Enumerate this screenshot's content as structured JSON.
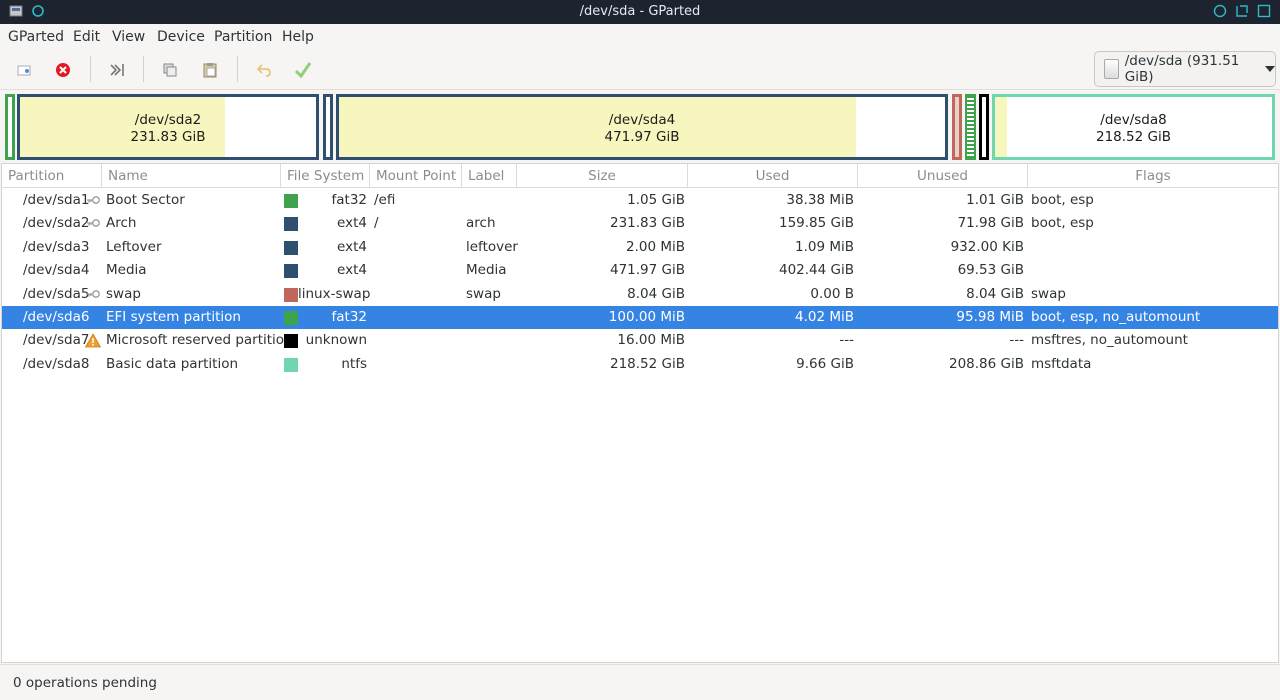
{
  "window": {
    "title": "/dev/sda - GParted"
  },
  "menu": [
    "GParted",
    "Edit",
    "View",
    "Device",
    "Partition",
    "Help"
  ],
  "toolbar": {
    "icons": [
      "new-partition-icon",
      "delete-icon",
      "resize-move-icon",
      "copy-icon",
      "paste-icon",
      "undo-icon",
      "apply-icon"
    ]
  },
  "device_selector": {
    "label": "/dev/sda (931.51 GiB)",
    "icon": "disk-icon"
  },
  "partition_map": {
    "segments": [
      {
        "name": "/dev/sda2",
        "size": "231.83 GiB",
        "used_fraction": 0.69
      },
      {
        "name": "/dev/sda4",
        "size": "471.97 GiB",
        "used_fraction": 0.853
      },
      {
        "name": "/dev/sda8",
        "size": "218.52 GiB",
        "used_fraction": 0.044
      }
    ]
  },
  "columns": [
    "Partition",
    "Name",
    "File System",
    "Mount Point",
    "Label",
    "Size",
    "Used",
    "Unused",
    "Flags"
  ],
  "rows": [
    {
      "partition": "/dev/sda1",
      "icon": "key-icon",
      "name": "Boot Sector",
      "fs_color": "#3fa34d",
      "fs": "fat32",
      "mount": "/efi",
      "label": "",
      "size": "1.05 GiB",
      "used": "38.38 MiB",
      "unused": "1.01 GiB",
      "flags": "boot, esp"
    },
    {
      "partition": "/dev/sda2",
      "icon": "key-icon",
      "name": "Arch",
      "fs_color": "#2f4f6f",
      "fs": "ext4",
      "mount": "/",
      "label": "arch",
      "size": "231.83 GiB",
      "used": "159.85 GiB",
      "unused": "71.98 GiB",
      "flags": "boot, esp"
    },
    {
      "partition": "/dev/sda3",
      "icon": "",
      "name": "Leftover",
      "fs_color": "#2f4f6f",
      "fs": "ext4",
      "mount": "",
      "label": "leftover",
      "size": "2.00 MiB",
      "used": "1.09 MiB",
      "unused": "932.00 KiB",
      "flags": ""
    },
    {
      "partition": "/dev/sda4",
      "icon": "",
      "name": "Media",
      "fs_color": "#2f4f6f",
      "fs": "ext4",
      "mount": "",
      "label": "Media",
      "size": "471.97 GiB",
      "used": "402.44 GiB",
      "unused": "69.53 GiB",
      "flags": ""
    },
    {
      "partition": "/dev/sda5",
      "icon": "key-icon",
      "name": "swap",
      "fs_color": "#c1665a",
      "fs": "linux-swap",
      "mount": "",
      "label": "swap",
      "size": "8.04 GiB",
      "used": "0.00 B",
      "unused": "8.04 GiB",
      "flags": "swap"
    },
    {
      "partition": "/dev/sda6",
      "icon": "",
      "name": "EFI system partition",
      "fs_color": "#3fa34d",
      "fs": "fat32",
      "mount": "",
      "label": "",
      "size": "100.00 MiB",
      "used": "4.02 MiB",
      "unused": "95.98 MiB",
      "flags": "boot, esp, no_automount"
    },
    {
      "partition": "/dev/sda7",
      "icon": "warning-icon",
      "name": "Microsoft reserved partition",
      "fs_color": "#000000",
      "fs": "unknown",
      "mount": "",
      "label": "",
      "size": "16.00 MiB",
      "used": "---",
      "unused": "---",
      "flags": "msftres, no_automount"
    },
    {
      "partition": "/dev/sda8",
      "icon": "",
      "name": "Basic data partition",
      "fs_color": "#6fd6b0",
      "fs": "ntfs",
      "mount": "",
      "label": "",
      "size": "218.52 GiB",
      "used": "9.66 GiB",
      "unused": "208.86 GiB",
      "flags": "msftdata"
    }
  ],
  "selected_row": "/dev/sda6",
  "status": "0 operations pending",
  "colors": {
    "selection": "#3584e4",
    "used_fill": "#f7f6be",
    "ext4_border": "#2f4f6f",
    "fat32": "#3fa34d",
    "swap": "#c1665a",
    "ntfs": "#6fd6b0"
  }
}
